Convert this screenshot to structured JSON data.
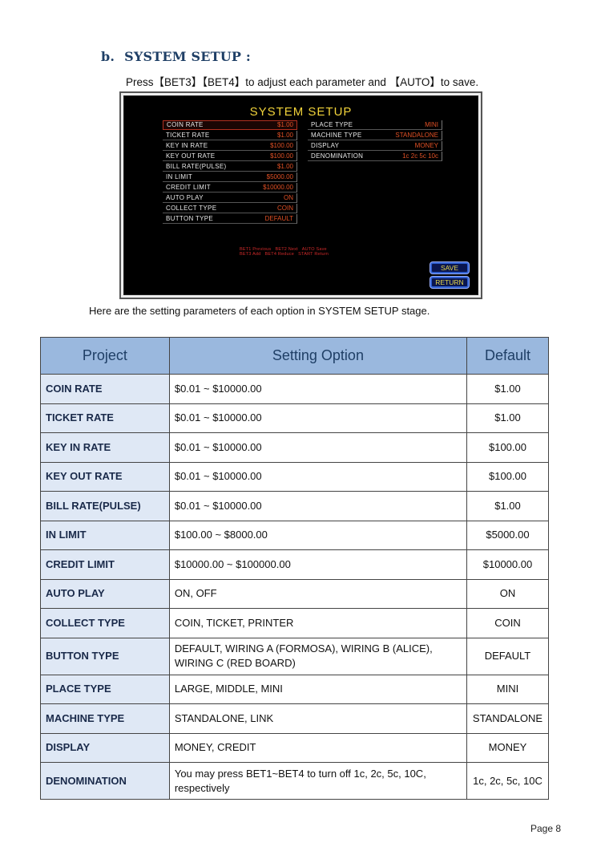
{
  "section": {
    "letter": "b.",
    "title": "SYSTEM SETUP :",
    "intro": "Press【BET3】【BET4】to adjust each parameter and 【AUTO】to save."
  },
  "screen": {
    "title": "SYSTEM SETUP",
    "left_params": [
      {
        "name": "COIN RATE",
        "value": "$1.00"
      },
      {
        "name": "TICKET RATE",
        "value": "$1.00"
      },
      {
        "name": "KEY IN RATE",
        "value": "$100.00"
      },
      {
        "name": "KEY OUT RATE",
        "value": "$100.00"
      },
      {
        "name": "BILL RATE(PULSE)",
        "value": "$1.00"
      },
      {
        "name": "IN LIMIT",
        "value": "$5000.00"
      },
      {
        "name": "CREDIT LIMIT",
        "value": "$10000.00"
      },
      {
        "name": "AUTO PLAY",
        "value": "ON"
      },
      {
        "name": "COLLECT TYPE",
        "value": "COIN"
      },
      {
        "name": "BUTTON TYPE",
        "value": "DEFAULT"
      }
    ],
    "right_params": [
      {
        "name": "PLACE TYPE",
        "value": "MINI"
      },
      {
        "name": "MACHINE TYPE",
        "value": "STANDALONE"
      },
      {
        "name": "DISPLAY",
        "value": "MONEY"
      },
      {
        "name": "DENOMINATION",
        "value": "1c 2c 5c 10c"
      }
    ],
    "hint_line1": "BET1 Previous   BET2 Next   AUTO Save",
    "hint_line2": "BET3 Add   BET4 Reduce   START Return",
    "save_label": "SAVE",
    "return_label": "RETURN"
  },
  "caption": "Here are the setting parameters of each option in SYSTEM SETUP stage.",
  "table": {
    "headers": [
      "Project",
      "Setting Option",
      "Default"
    ],
    "rows": [
      {
        "project": "COIN RATE",
        "option": "$0.01 ~ $10000.00",
        "default": "$1.00"
      },
      {
        "project": "TICKET RATE",
        "option": "$0.01 ~ $10000.00",
        "default": "$1.00"
      },
      {
        "project": "KEY IN RATE",
        "option": "$0.01 ~ $10000.00",
        "default": "$100.00"
      },
      {
        "project": "KEY OUT RATE",
        "option": "$0.01 ~ $10000.00",
        "default": "$100.00"
      },
      {
        "project": "BILL RATE(PULSE)",
        "option": "$0.01 ~ $10000.00",
        "default": "$1.00"
      },
      {
        "project": "IN LIMIT",
        "option": "$100.00 ~ $8000.00",
        "default": "$5000.00"
      },
      {
        "project": "CREDIT LIMIT",
        "option": "$10000.00 ~ $100000.00",
        "default": "$10000.00"
      },
      {
        "project": "AUTO PLAY",
        "option": "ON, OFF",
        "default": "ON"
      },
      {
        "project": "COLLECT TYPE",
        "option": "COIN, TICKET, PRINTER",
        "default": "COIN"
      },
      {
        "project": "BUTTON TYPE",
        "option": "DEFAULT, WIRING A (FORMOSA), WIRING B (ALICE), WIRING C (RED BOARD)",
        "default": "DEFAULT"
      },
      {
        "project": "PLACE TYPE",
        "option": "LARGE, MIDDLE, MINI",
        "default": "MINI"
      },
      {
        "project": "MACHINE TYPE",
        "option": "STANDALONE, LINK",
        "default": "STANDALONE"
      },
      {
        "project": "DISPLAY",
        "option": "MONEY, CREDIT",
        "default": "MONEY"
      },
      {
        "project": "DENOMINATION",
        "option": "You may press BET1~BET4 to turn off 1c, 2c, 5c, 10C, respectively",
        "default": "1c, 2c, 5c, 10C"
      }
    ]
  },
  "footer": {
    "page": "Page  8"
  }
}
